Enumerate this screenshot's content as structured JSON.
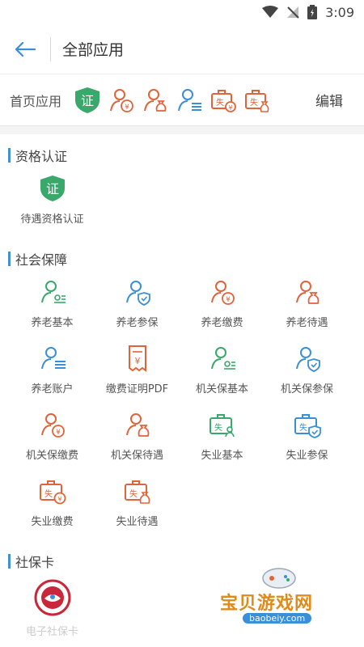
{
  "status_bar": {
    "time": "3:09"
  },
  "app_bar": {
    "title": "全部应用"
  },
  "home_apps": {
    "label": "首页应用",
    "edit": "编辑"
  },
  "sections": [
    {
      "name": "资格认证",
      "items": [
        {
          "label": "待遇资格认证",
          "icon": "cert-shield-icon"
        }
      ]
    },
    {
      "name": "社会保障",
      "items": [
        {
          "label": "养老基本",
          "icon": "person-basic-icon"
        },
        {
          "label": "养老参保",
          "icon": "person-shield-icon"
        },
        {
          "label": "养老缴费",
          "icon": "person-yen-icon"
        },
        {
          "label": "养老待遇",
          "icon": "person-moneybag-icon"
        },
        {
          "label": "养老账户",
          "icon": "person-list-icon"
        },
        {
          "label": "缴费证明PDF",
          "icon": "receipt-yen-icon"
        },
        {
          "label": "机关保基本",
          "icon": "person-basic-icon"
        },
        {
          "label": "机关保参保",
          "icon": "person-shield-icon"
        },
        {
          "label": "机关保缴费",
          "icon": "person-yen-icon"
        },
        {
          "label": "机关保待遇",
          "icon": "person-moneybag-icon"
        },
        {
          "label": "失业基本",
          "icon": "briefcase-person-icon"
        },
        {
          "label": "失业参保",
          "icon": "briefcase-shield-icon"
        },
        {
          "label": "失业缴费",
          "icon": "briefcase-yen-icon"
        },
        {
          "label": "失业待遇",
          "icon": "briefcase-moneybag-icon"
        }
      ]
    },
    {
      "name": "社保卡",
      "items": [
        {
          "label": "电子社保卡",
          "icon": "social-card-emblem-icon"
        }
      ]
    }
  ],
  "colors": {
    "green": "#3aa86a",
    "blue": "#3a8fd9",
    "orange": "#e0643a",
    "accent_bar": "#3f8fd9"
  },
  "watermark": {
    "text": "宝贝游戏网",
    "url": "baobeiy.com"
  }
}
